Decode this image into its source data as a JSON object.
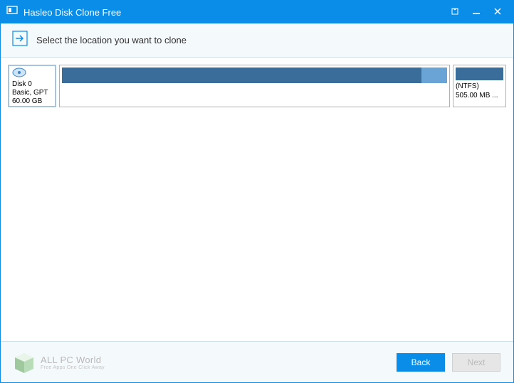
{
  "titlebar": {
    "title": "Hasleo Disk Clone Free"
  },
  "subheader": {
    "text": "Select the location you want to clone"
  },
  "disk": {
    "name": "Disk 0",
    "type": "Basic, GPT",
    "size": "60.00 GB"
  },
  "partition_side": {
    "fs": "(NTFS)",
    "size": "505.00 MB ..."
  },
  "watermark": {
    "title": "ALL PC World",
    "subtitle": "Free Apps One Click Away"
  },
  "footer": {
    "back": "Back",
    "next": "Next"
  }
}
